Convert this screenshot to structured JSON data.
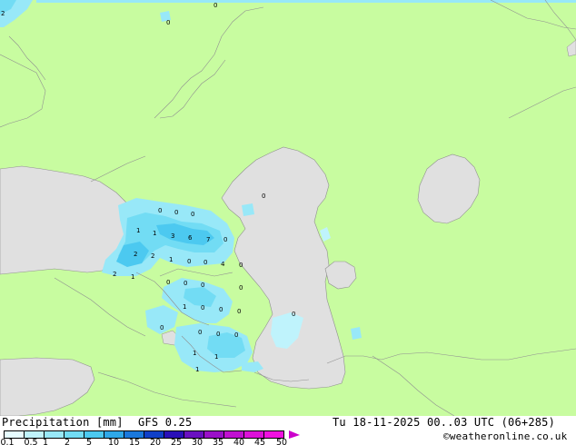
{
  "map": {
    "contour_labels": [
      "2",
      "0",
      "0",
      "0",
      "0",
      "0",
      "1",
      "1",
      "3",
      "6",
      "7",
      "0",
      "2",
      "2",
      "1",
      "0",
      "0",
      "4",
      "0",
      "2",
      "1",
      "0",
      "0",
      "0",
      "1",
      "0",
      "0",
      "0",
      "0",
      "0",
      "0",
      "0",
      "0",
      "1",
      "1",
      "1",
      "0",
      "0"
    ]
  },
  "footer": {
    "title": "Precipitation [mm]",
    "model": "GFS 0.25",
    "valid_time": "Tu 18-11-2025 00..03 UTC (06+285)",
    "credit": "©weatheronline.co.uk",
    "scale_labels": [
      "0.1",
      "0.5",
      "1",
      "2",
      "5",
      "10",
      "15",
      "20",
      "25",
      "30",
      "35",
      "40",
      "45",
      "50"
    ],
    "scale_colors": [
      "#e6fcff",
      "#bff3fc",
      "#98e8f8",
      "#72dcf4",
      "#4cc9f0",
      "#2fa8e8",
      "#1a78dc",
      "#1040c8",
      "#2a10b8",
      "#6a10c0",
      "#9a10c8",
      "#c010d0",
      "#dc10d8",
      "#f010e0"
    ]
  },
  "colors": {
    "land": "#c8fca0",
    "sea": "#e0e0e0",
    "border": "#909090"
  }
}
